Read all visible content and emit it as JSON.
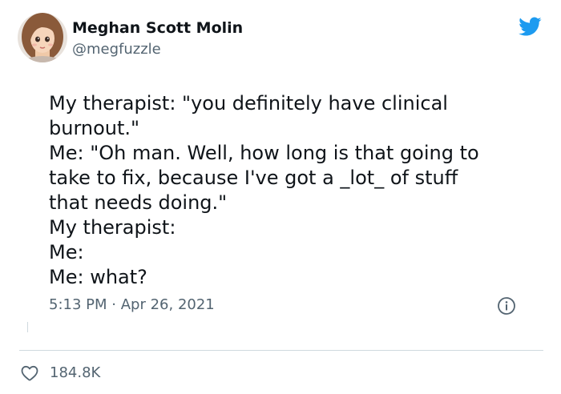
{
  "author": {
    "display_name": "Meghan Scott Molin",
    "handle": "@megfuzzle",
    "avatar": "profile-photo"
  },
  "tweet": {
    "lines": [
      "My therapist: \"you definitely have clinical",
      "burnout.\"",
      "Me: \"Oh man. Well, how long is that going to",
      "take to fix, because I've got a _lot_ of stuff",
      "that needs doing.\"",
      "My therapist:",
      "Me:",
      "Me: what?"
    ],
    "time": "5:13 PM",
    "separator": "·",
    "date": "Apr 26, 2021"
  },
  "actions": {
    "like_count": "184.8K",
    "like_icon": "heart-icon",
    "info_icon": "info-icon"
  },
  "brand": {
    "icon": "twitter-bird-icon",
    "color": "#1d9bf0"
  }
}
